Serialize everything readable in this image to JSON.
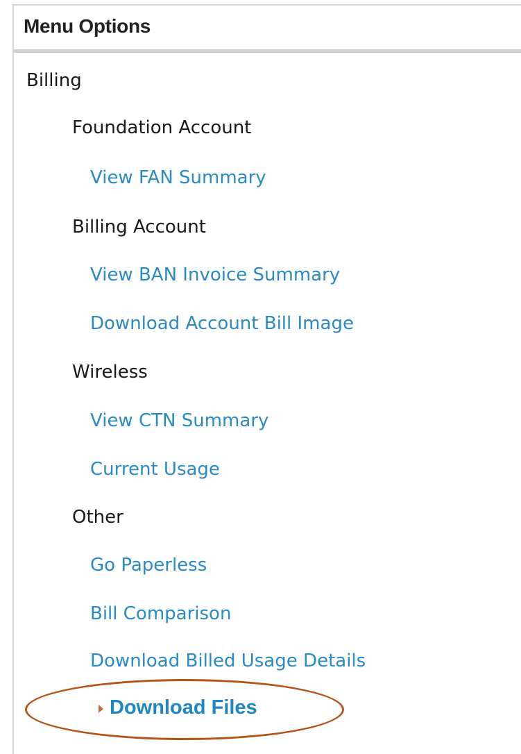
{
  "panel": {
    "title": "Menu Options"
  },
  "menu": {
    "section": "Billing",
    "groups": [
      {
        "label": "Foundation Account",
        "links": [
          "View FAN Summary"
        ]
      },
      {
        "label": "Billing Account",
        "links": [
          "View BAN Invoice Summary",
          "Download Account Bill Image"
        ]
      },
      {
        "label": "Wireless",
        "links": [
          "View CTN Summary",
          "Current Usage"
        ]
      },
      {
        "label": "Other",
        "links": [
          "Go Paperless",
          "Bill Comparison",
          "Download Billed Usage Details"
        ]
      }
    ],
    "active_link": "Download Files",
    "active_marker_icon": "arrow-right-icon"
  },
  "colors": {
    "link": "#2a8bc4",
    "active_link": "#1f86c6",
    "heading_text": "#1a1a1a",
    "highlight_ring": "#b5541a",
    "header_border": "#d0d0d0"
  }
}
